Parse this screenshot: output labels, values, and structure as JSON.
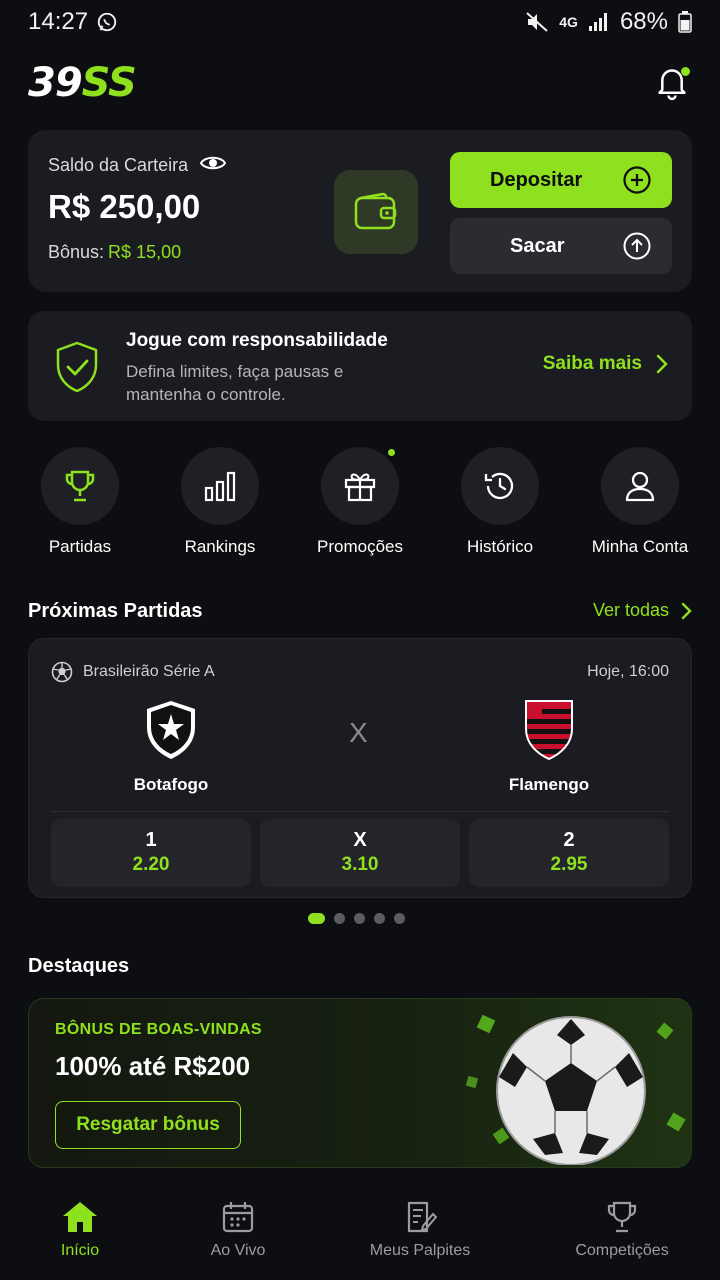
{
  "status_bar": {
    "time": "14:27",
    "network": "4G",
    "battery": "68%"
  },
  "header": {
    "logo_part1": "39",
    "logo_part2": "SS"
  },
  "wallet": {
    "label": "Saldo da Carteira",
    "amount": "R$ 250,00",
    "bonus_label": "Bônus:",
    "bonus_value": "R$ 15,00",
    "deposit_label": "Depositar",
    "withdraw_label": "Sacar"
  },
  "responsible": {
    "title": "Jogue com responsabilidade",
    "description": "Defina limites, faça pausas e mantenha o controle.",
    "link": "Saiba mais"
  },
  "quick_actions": [
    {
      "label": "Partidas",
      "icon": "trophy-icon"
    },
    {
      "label": "Rankings",
      "icon": "bar-chart-icon"
    },
    {
      "label": "Promoções",
      "icon": "gift-icon"
    },
    {
      "label": "Histórico",
      "icon": "history-icon"
    },
    {
      "label": "Minha Conta",
      "icon": "user-icon"
    }
  ],
  "matches_section": {
    "title": "Próximas Partidas",
    "see_all": "Ver todas"
  },
  "match": {
    "league": "Brasileirão Série A",
    "time": "Hoje, 16:00",
    "home": "Botafogo",
    "away": "Flamengo",
    "vs": "X",
    "odds": [
      {
        "label": "1",
        "value": "2.20"
      },
      {
        "label": "X",
        "value": "3.10"
      },
      {
        "label": "2",
        "value": "2.95"
      }
    ]
  },
  "pager": {
    "count": 5,
    "active": 0
  },
  "highlights": {
    "title": "Destaques",
    "tag": "BÔNUS DE BOAS-VINDAS",
    "headline": "100% até R$200",
    "button": "Resgatar bônus"
  },
  "bottom_nav": [
    {
      "label": "Início",
      "icon": "home-icon",
      "active": true
    },
    {
      "label": "Ao Vivo",
      "icon": "calendar-icon",
      "active": false
    },
    {
      "label": "Meus Palpites",
      "icon": "notepad-icon",
      "active": false
    },
    {
      "label": "Competições",
      "icon": "trophy-icon",
      "active": false
    }
  ],
  "colors": {
    "accent": "#8fe01e",
    "background": "#0d0e11",
    "card": "#1a1c21"
  }
}
